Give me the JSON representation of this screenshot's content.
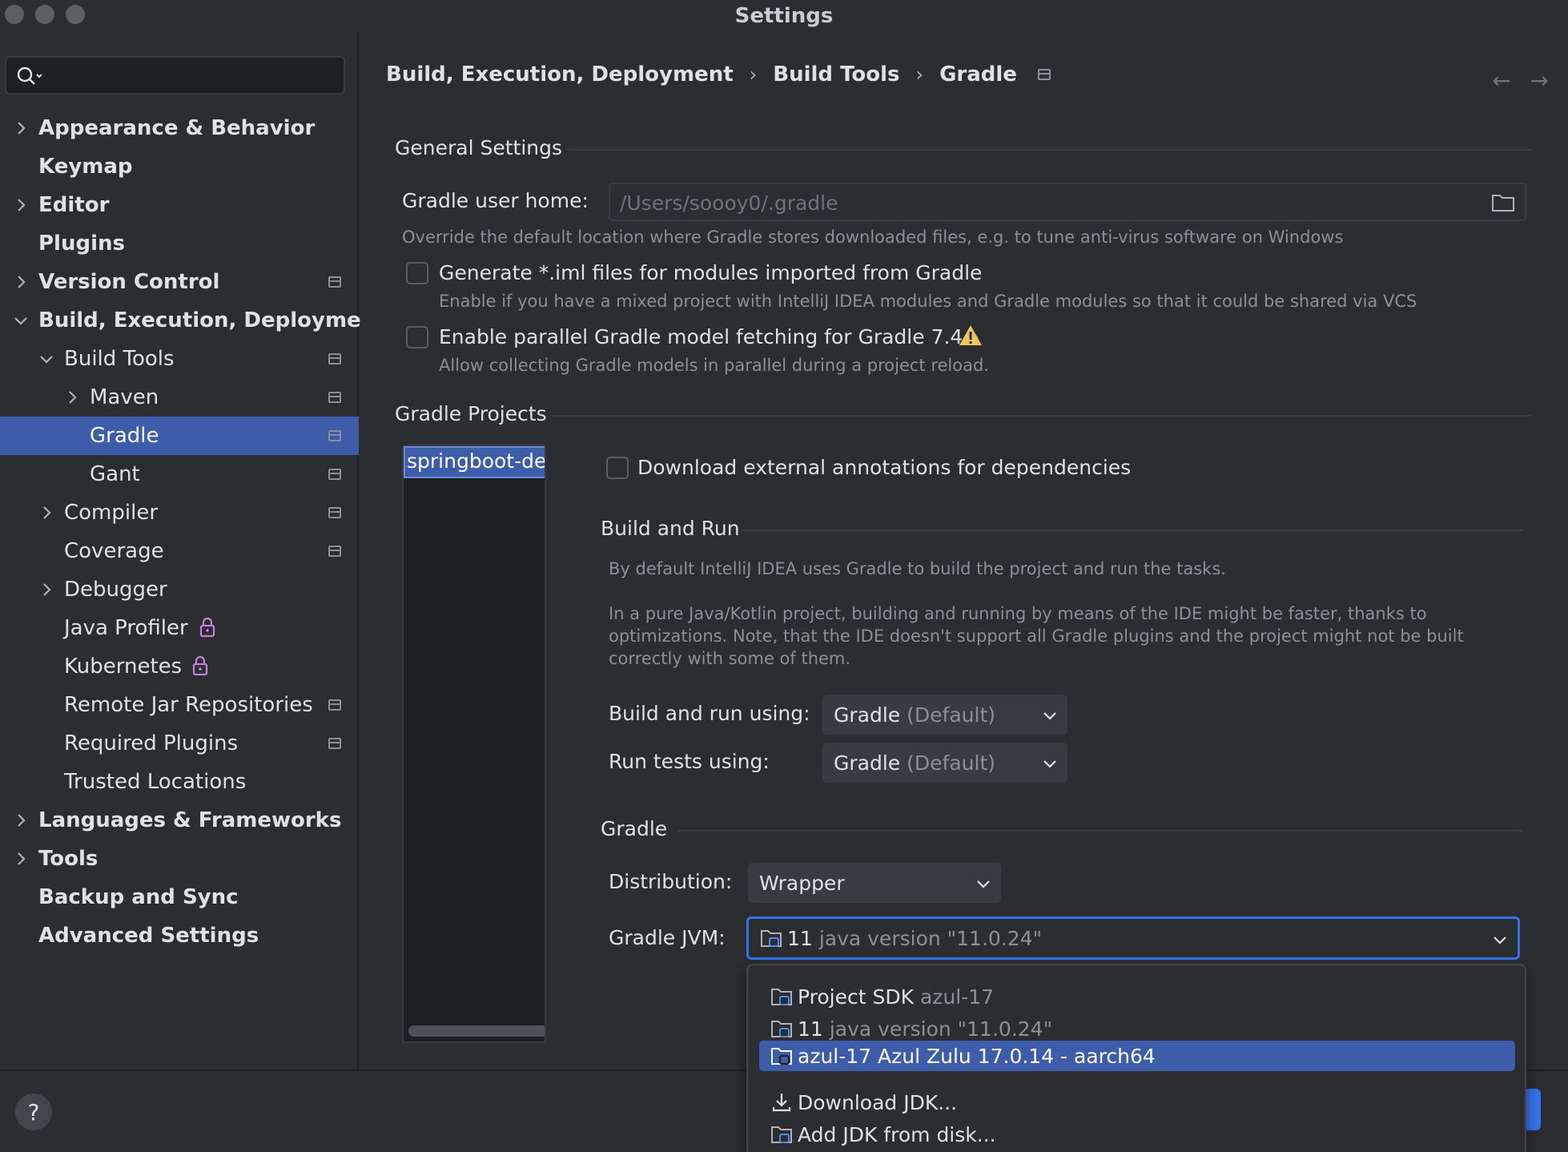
{
  "window": {
    "title": "Settings"
  },
  "search": {
    "placeholder": ""
  },
  "sidebar": {
    "items": [
      {
        "label": "Appearance & Behavior"
      },
      {
        "label": "Keymap"
      },
      {
        "label": "Editor"
      },
      {
        "label": "Plugins"
      },
      {
        "label": "Version Control"
      },
      {
        "label": "Build, Execution, Deployment"
      },
      {
        "label": "Build Tools"
      },
      {
        "label": "Maven"
      },
      {
        "label": "Gradle"
      },
      {
        "label": "Gant"
      },
      {
        "label": "Compiler"
      },
      {
        "label": "Coverage"
      },
      {
        "label": "Debugger"
      },
      {
        "label": "Java Profiler"
      },
      {
        "label": "Kubernetes"
      },
      {
        "label": "Remote Jar Repositories"
      },
      {
        "label": "Required Plugins"
      },
      {
        "label": "Trusted Locations"
      },
      {
        "label": "Languages & Frameworks"
      },
      {
        "label": "Tools"
      },
      {
        "label": "Backup and Sync"
      },
      {
        "label": "Advanced Settings"
      }
    ]
  },
  "breadcrumb": {
    "part1": "Build, Execution, Deployment",
    "part2": "Build Tools",
    "part3": "Gradle",
    "sep": "›"
  },
  "nav": {
    "back": "←",
    "forward": "→"
  },
  "general": {
    "title": "General Settings",
    "user_home_label": "Gradle user home:",
    "user_home_placeholder": "/Users/soooy0/.gradle",
    "user_home_hint": "Override the default location where Gradle stores downloaded files, e.g. to tune anti-virus software on Windows",
    "iml_label": "Generate *.iml files for modules imported from Gradle",
    "iml_hint": "Enable if you have a mixed project with IntelliJ IDEA modules and Gradle modules so that it could be shared via VCS",
    "parallel_label": "Enable parallel Gradle model fetching for Gradle 7.4+",
    "parallel_hint": "Allow collecting Gradle models in parallel during a project reload."
  },
  "projects": {
    "title": "Gradle Projects",
    "items": [
      "springboot-develo"
    ],
    "annotations_label": "Download external annotations for dependencies"
  },
  "build_run": {
    "title": "Build and Run",
    "text1": "By default IntelliJ IDEA uses Gradle to build the project and run the tasks.",
    "text2": "In a pure Java/Kotlin project, building and running by means of the IDE might be faster, thanks to\noptimizations. Note, that the IDE doesn't support all Gradle plugins and the project might not be built\ncorrectly with some of them.",
    "build_using_label": "Build and run using:",
    "build_using_value": "Gradle",
    "build_using_suffix": "(Default)",
    "tests_using_label": "Run tests using:",
    "tests_using_value": "Gradle",
    "tests_using_suffix": "(Default)"
  },
  "gradle": {
    "title": "Gradle",
    "distribution_label": "Distribution:",
    "distribution_value": "Wrapper",
    "jvm_label": "Gradle JVM:",
    "jvm_value": "11",
    "jvm_suffix": "java version \"11.0.24\""
  },
  "jvm_options": [
    {
      "name": "Project SDK",
      "detail": "azul-17"
    },
    {
      "name": "11",
      "detail": "java version \"11.0.24\""
    },
    {
      "name": "azul-17 Azul Zulu 17.0.14 - aarch64",
      "detail": ""
    },
    {
      "name": "Download JDK...",
      "detail": ""
    },
    {
      "name": "Add JDK from disk...",
      "detail": ""
    }
  ],
  "footer": {
    "help": "?"
  },
  "colors": {
    "selection": "#3d5ca9",
    "accent": "#3574f0",
    "warning": "#f2c55c",
    "lock": "#c77dde"
  }
}
